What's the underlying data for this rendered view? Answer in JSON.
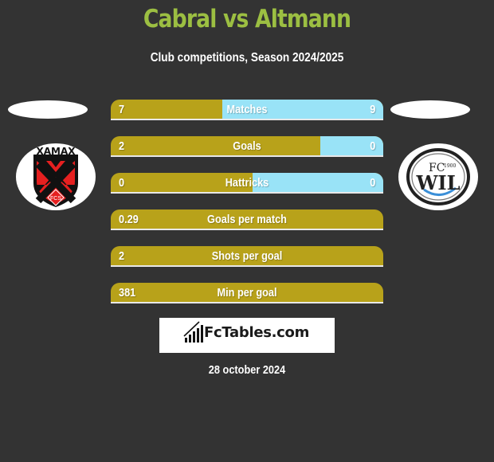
{
  "header": {
    "title": "Cabral vs Altmann",
    "subtitle": "Club competitions, Season 2024/2025"
  },
  "players": {
    "left": {
      "name": "Cabral",
      "club_logo": "xamax-crest-icon",
      "club_logo_text": "XAMAX",
      "club_logo_sub": "FCS"
    },
    "right": {
      "name": "Altmann",
      "club_logo": "fc-wil-crest-icon",
      "club_logo_text": "FC WIL",
      "club_logo_year": "1900"
    }
  },
  "colors": {
    "background": "#333333",
    "title": "#9cbf42",
    "left_bar": "#b8a21a",
    "right_bar": "#99e3f7"
  },
  "stats": [
    {
      "label": "Matches",
      "left": "7",
      "right": "9",
      "left_share": 0.41
    },
    {
      "label": "Goals",
      "left": "2",
      "right": "0",
      "left_share": 0.77
    },
    {
      "label": "Hattricks",
      "left": "0",
      "right": "0",
      "left_share": 0.52
    },
    {
      "label": "Goals per match",
      "left": "0.29",
      "right": "",
      "left_share": 1.0
    },
    {
      "label": "Shots per goal",
      "left": "2",
      "right": "",
      "left_share": 1.0
    },
    {
      "label": "Min per goal",
      "left": "381",
      "right": "",
      "left_share": 1.0
    }
  ],
  "brand": {
    "icon": "bar-chart-icon",
    "text": "FcTables.com"
  },
  "date": "28 october 2024"
}
